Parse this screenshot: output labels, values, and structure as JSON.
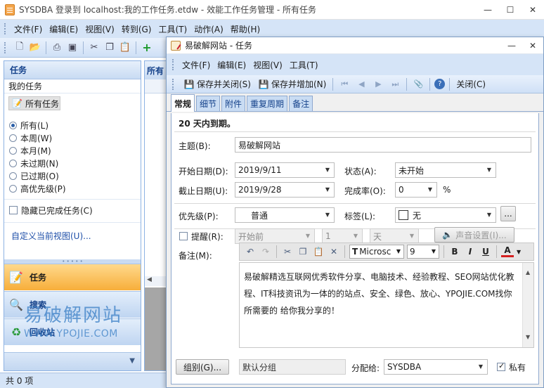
{
  "window": {
    "title": "SYSDBA 登录到 localhost:我的工作任务.etdw - 效能工作任务管理 - 所有任务",
    "min_label": "—",
    "max_label": "☐",
    "close_label": "✕"
  },
  "menu": [
    "文件(F)",
    "编辑(E)",
    "视图(V)",
    "转到(G)",
    "工具(T)",
    "动作(A)",
    "帮助(H)"
  ],
  "nav": {
    "header": "任务",
    "subheader": "我的任务",
    "all_tasks": "所有任务",
    "filters": [
      {
        "label": "所有(L)",
        "checked": true
      },
      {
        "label": "本周(W)",
        "checked": false
      },
      {
        "label": "本月(M)",
        "checked": false
      },
      {
        "label": "未过期(N)",
        "checked": false
      },
      {
        "label": "已过期(O)",
        "checked": false
      },
      {
        "label": "高优先级(P)",
        "checked": false
      }
    ],
    "hide_completed": "隐藏已完成任务(C)",
    "customize_view": "自定义当前视图(U)...",
    "buttons": {
      "tasks": "任务",
      "search": "搜索",
      "recycle": "回收站"
    }
  },
  "list": {
    "header": "所有"
  },
  "status": {
    "text": "共 0 项"
  },
  "dialog": {
    "title": "易破解网站 - 任务",
    "menu": [
      "文件(F)",
      "编辑(E)",
      "视图(V)",
      "工具(T)"
    ],
    "toolbar": {
      "save_close": "保存并关闭(S)",
      "save_add": "保存并增加(N)",
      "close": "关闭(C)"
    },
    "tabs": [
      "常规",
      "细节",
      "附件",
      "重复周期",
      "备注"
    ],
    "due_text": "20 天内到期。",
    "subject_label": "主题(B):",
    "subject_value": "易破解网站",
    "start_label": "开始日期(D):",
    "start_value": "2019/9/11",
    "due_label": "截止日期(U):",
    "due_value": "2019/9/28",
    "status_label": "状态(A):",
    "status_value": "未开始",
    "percent_label": "完成率(O):",
    "percent_value": "0",
    "percent_unit": "%",
    "priority_label": "优先级(P):",
    "priority_value": "普通",
    "tag_label": "标签(L):",
    "tag_value": "无",
    "tag_more": "...",
    "remind_label": "提醒(R):",
    "remind_when": "开始前",
    "remind_count": "1",
    "remind_unit": "天",
    "sound_btn": "声音设置(I)...",
    "notes_label": "备注(M):",
    "font_name": "Microsc",
    "font_size": "9",
    "fmt_bold": "B",
    "fmt_italic": "I",
    "fmt_underline": "U",
    "fmt_color": "A",
    "notes_text": "易破解精选互联网优秀软件分享、电脑技术、经验教程、SEO网站优化教程、IT科技资讯为一体的的站点、安全、绿色、放心、YPOJIE.COM找你所需要的 给你我分享的！",
    "group_btn": "组别(G)...",
    "group_value": "默认分组",
    "assign_label": "分配给:",
    "assign_value": "SYSDBA",
    "private_label": "私有"
  },
  "watermark": {
    "cn": "易破解网站",
    "url": "WWW.YPOJIE.COM"
  },
  "colors": {
    "accent": "#15428b",
    "nav_active": "#f7ae3a",
    "ribbon": "#d5e4f7"
  }
}
